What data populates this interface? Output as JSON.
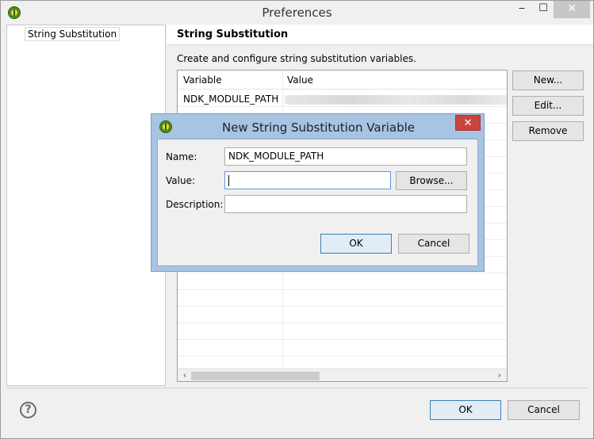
{
  "window": {
    "title": "Preferences",
    "minimize": "‒",
    "maximize": "☐",
    "close": "✕"
  },
  "nav": {
    "items": [
      "String Substitution"
    ]
  },
  "page": {
    "title": "String Substitution",
    "description": "Create and configure string substitution variables.",
    "table": {
      "headers": [
        "Variable",
        "Value"
      ],
      "rows": [
        {
          "variable": "NDK_MODULE_PATH",
          "value": ""
        }
      ],
      "scroll_left": "‹",
      "scroll_right": "›"
    },
    "buttons": {
      "new": "New...",
      "edit": "Edit...",
      "remove": "Remove"
    }
  },
  "footer": {
    "help": "?",
    "ok": "OK",
    "cancel": "Cancel"
  },
  "dialog": {
    "title": "New String Substitution Variable",
    "close": "✕",
    "name_label": "Name:",
    "name_value": "NDK_MODULE_PATH",
    "value_label": "Value:",
    "value_value": "",
    "browse": "Browse...",
    "description_label": "Description:",
    "description_value": "",
    "ok": "OK",
    "cancel": "Cancel"
  }
}
